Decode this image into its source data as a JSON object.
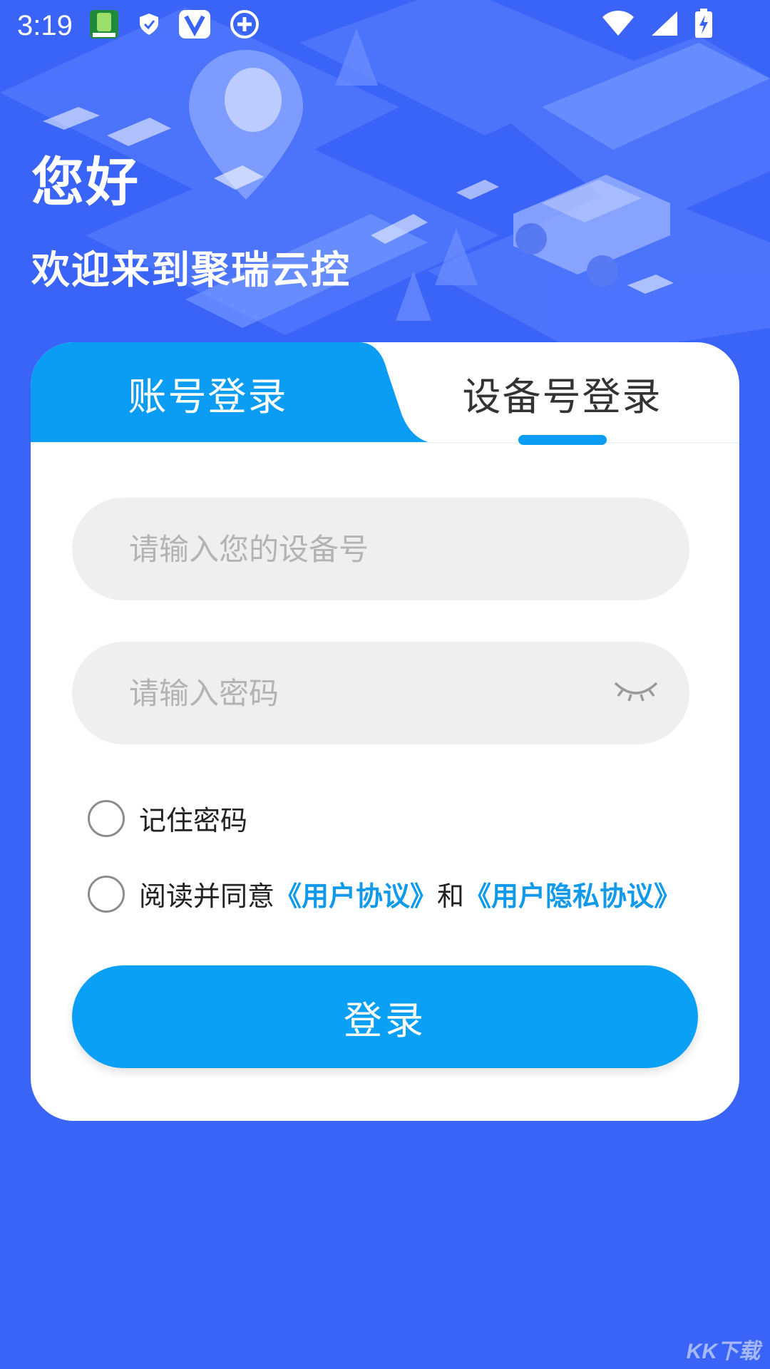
{
  "status_bar": {
    "time": "3:19",
    "left_icons": [
      "app-badge-icon",
      "shield-icon",
      "vpn-v-icon",
      "add-circle-icon"
    ],
    "right_icons": [
      "wifi-icon",
      "cell-signal-icon",
      "battery-charging-icon"
    ]
  },
  "header": {
    "greeting": "您好",
    "welcome": "欢迎来到聚瑞云控"
  },
  "tabs": {
    "account_label": "账号登录",
    "device_label": "设备号登录",
    "active": "device"
  },
  "form": {
    "device_placeholder": "请输入您的设备号",
    "password_placeholder": "请输入密码",
    "remember_label": "记住密码",
    "agree_prefix": "阅读并同意",
    "user_agreement": "《用户协议》",
    "agree_and": "和",
    "privacy_agreement": "《用户隐私协议》",
    "login_label": "登录"
  },
  "colors": {
    "background": "#3a63f8",
    "tab_active": "#0a9df3",
    "button": "#0aa0f6",
    "link": "#1199ea"
  }
}
